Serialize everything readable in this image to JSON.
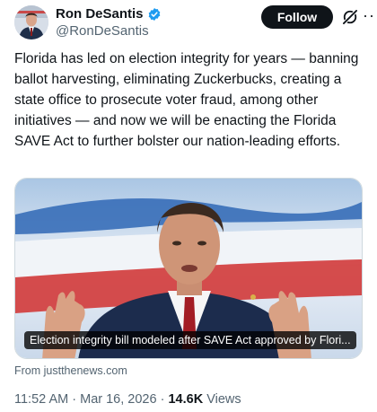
{
  "author": {
    "name": "Ron DeSantis",
    "handle": "@RonDeSantis",
    "verified": true
  },
  "actions": {
    "follow_label": "Follow",
    "grok_icon": "grok-icon",
    "more_icon": "more-icon",
    "more_label": "···"
  },
  "tweet": {
    "text": "Florida has led on election integrity for years — banning ballot harvesting, eliminating Zuckerbucks, creating a state office to prosecute voter fraud, among other initiatives — and now we will be enacting the Florida SAVE Act to further bolster our nation-leading efforts."
  },
  "media": {
    "caption": "Election integrity bill modeled after SAVE Act approved by Flori...",
    "source": "From justthenews.com"
  },
  "meta": {
    "time": "11:52 AM",
    "separator": "·",
    "date": "Mar 16, 2026",
    "views_count": "14.6K",
    "views_label": "Views"
  },
  "colors": {
    "verified": "#1d9bf0",
    "follow_bg": "#0f1419",
    "secondary_text": "#536471"
  }
}
